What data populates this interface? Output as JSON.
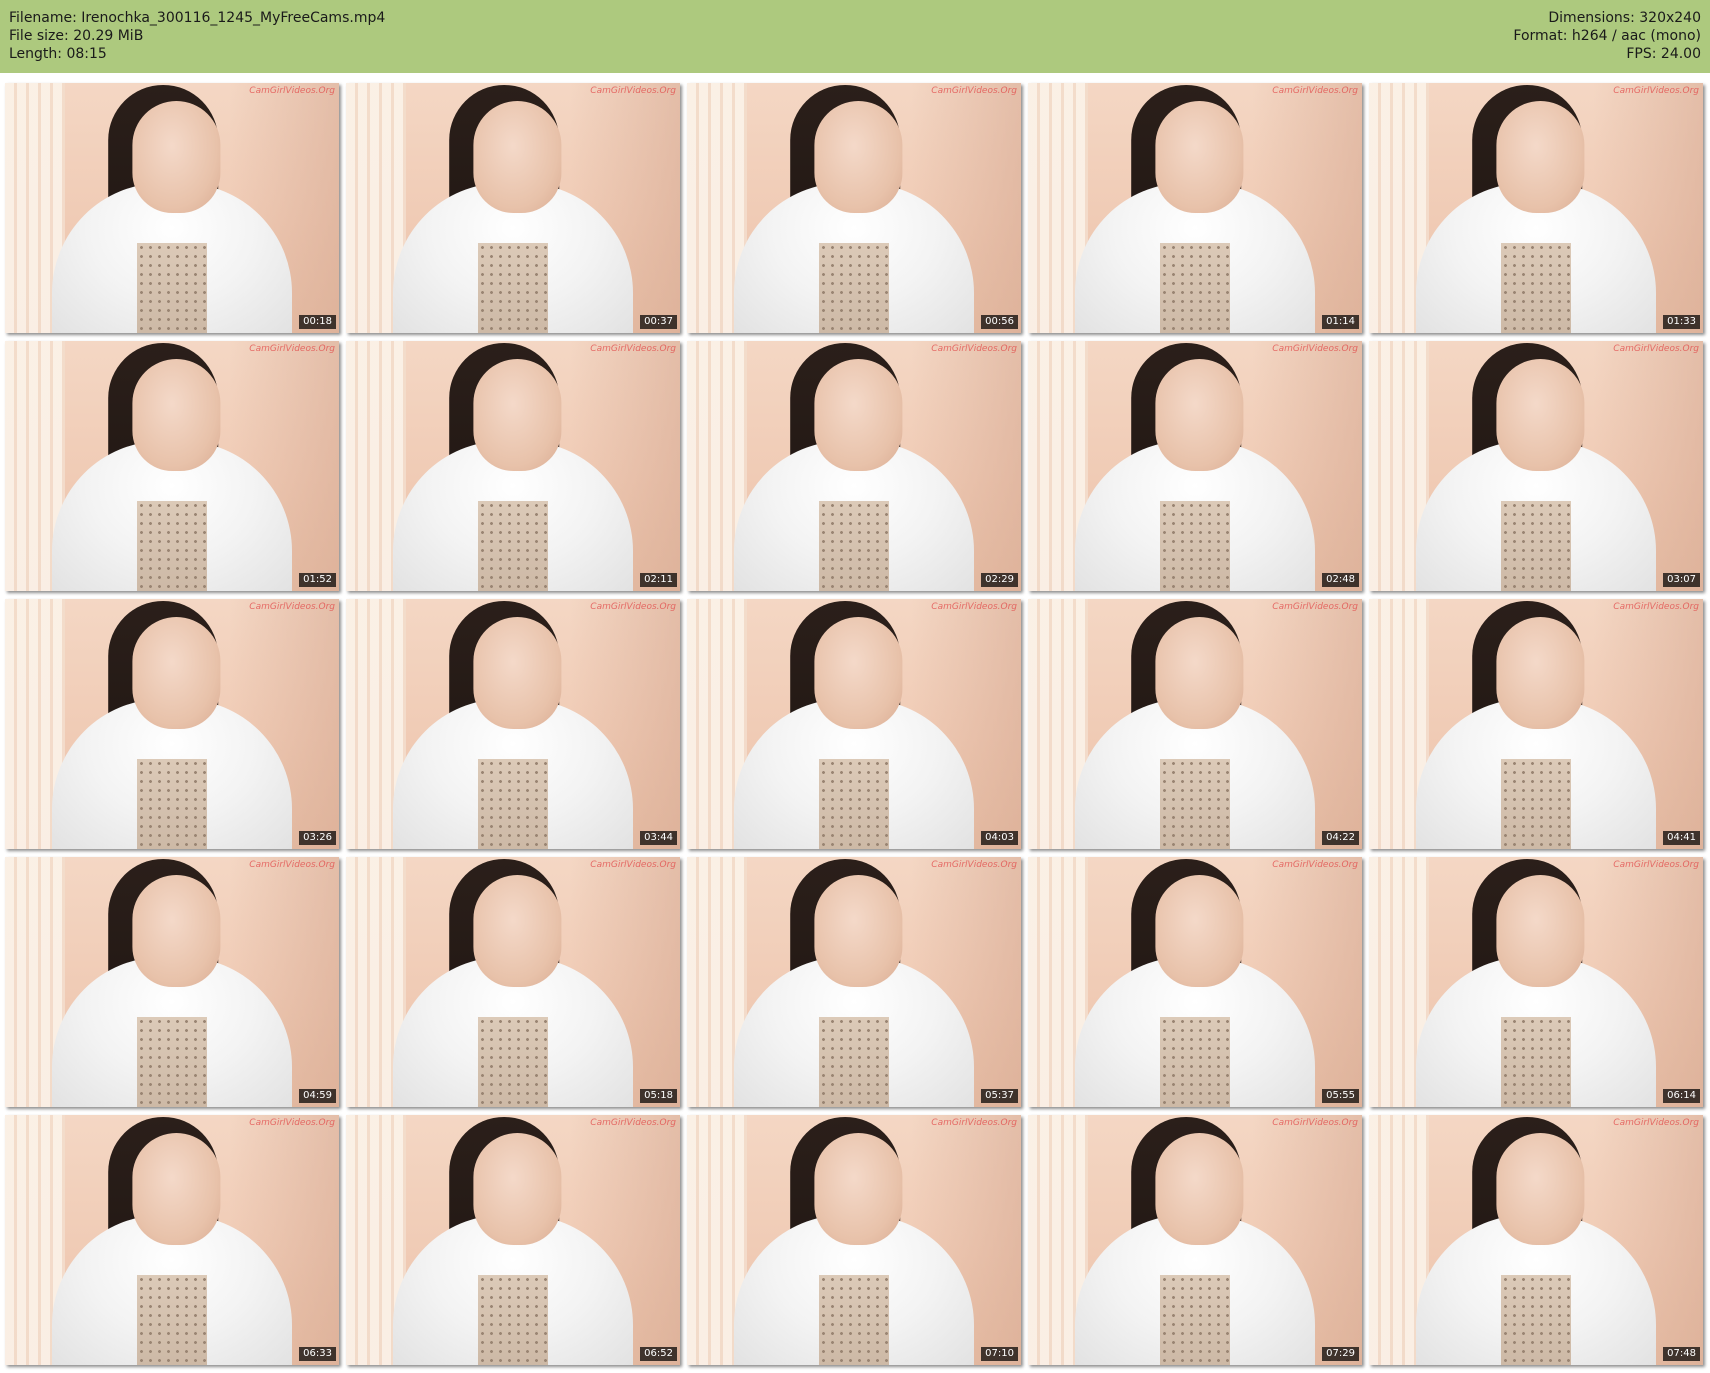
{
  "info": {
    "filename": "Filename: Irenochka_300116_1245_MyFreeCams.mp4",
    "filesize": "File size: 20.29 MiB",
    "length": "Length: 08:15",
    "dimensions": "Dimensions: 320x240",
    "format": "Format: h264 / aac (mono)",
    "fps": "FPS: 24.00"
  },
  "watermark": "CamGirlVideos.Org",
  "frames": [
    {
      "time": "00:18"
    },
    {
      "time": "00:37"
    },
    {
      "time": "00:56"
    },
    {
      "time": "01:14"
    },
    {
      "time": "01:33"
    },
    {
      "time": "01:52"
    },
    {
      "time": "02:11"
    },
    {
      "time": "02:29"
    },
    {
      "time": "02:48"
    },
    {
      "time": "03:07"
    },
    {
      "time": "03:26"
    },
    {
      "time": "03:44"
    },
    {
      "time": "04:03"
    },
    {
      "time": "04:22"
    },
    {
      "time": "04:41"
    },
    {
      "time": "04:59"
    },
    {
      "time": "05:18"
    },
    {
      "time": "05:37"
    },
    {
      "time": "05:55"
    },
    {
      "time": "06:14"
    },
    {
      "time": "06:33"
    },
    {
      "time": "06:52"
    },
    {
      "time": "07:10"
    },
    {
      "time": "07:29"
    },
    {
      "time": "07:48"
    }
  ]
}
